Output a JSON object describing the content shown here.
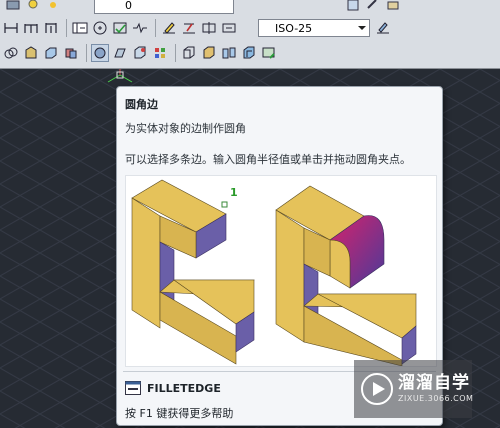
{
  "toolbar": {
    "dimstyle_value": "ISO-25",
    "layer_value": "0",
    "icons": [
      "text-style-icon",
      "dimension-icon",
      "save-icon",
      "copy-icon",
      "measure-icon",
      "orbit-icon",
      "pen-icon",
      "insert-icon",
      "solid-icon",
      "fillet-icon",
      "extract-icon"
    ]
  },
  "tooltip": {
    "title": "圆角边",
    "description": "为实体对象的边制作圆角",
    "hint": "可以选择多条边。输入圆角半径值或单击并拖动圆角夹点。",
    "figure_label": "1",
    "command": "FILLETEDGE",
    "help": "按 F1 键获得更多帮助"
  },
  "watermark": {
    "text": "溜溜自学",
    "url": "ZIXUE.3066.COM"
  },
  "colors": {
    "solid_face": "#e5c25a",
    "solid_side": "#6a5fa8",
    "fillet_gradient_start": "#d6226b",
    "fillet_gradient_end": "#4a3a9a",
    "canvas_bg": "#262b33"
  }
}
